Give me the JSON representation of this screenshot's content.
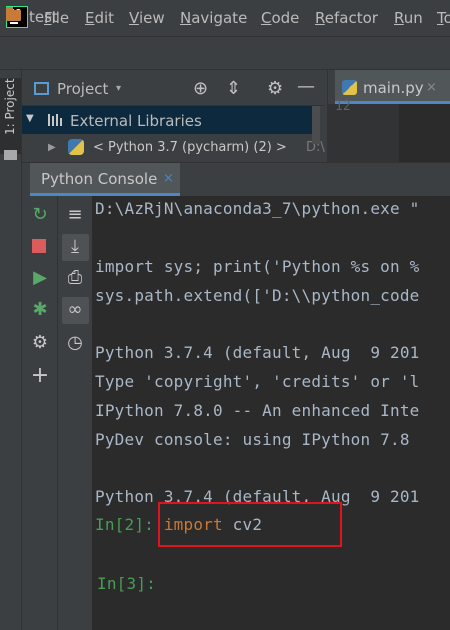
{
  "menubar": {
    "logo_text": "PC",
    "items": [
      "File",
      "Edit",
      "View",
      "Navigate",
      "Code",
      "Refactor",
      "Run",
      "To"
    ],
    "mnemonics": [
      "F",
      "E",
      "V",
      "N",
      "C",
      "R",
      "R",
      "T"
    ]
  },
  "navbar": {
    "project": "test"
  },
  "left_strip": {
    "project_tool": "1: Project"
  },
  "project_panel": {
    "title": "Project",
    "items": [
      {
        "label": "External Libraries",
        "selected": true,
        "expanded": true
      },
      {
        "label": "< Python 3.7 (pycharm) (2) >",
        "suffix": "D:\\",
        "expanded": false
      }
    ],
    "header_icons": [
      "crosshair-icon",
      "collapse-icon",
      "gear-icon",
      "hide-icon"
    ]
  },
  "editor": {
    "tab": "main.py",
    "tab_close": "×",
    "line_number": "12"
  },
  "console": {
    "tab": "Python Console",
    "tab_close": "×",
    "lines": [
      "D:\\AzRjN\\anaconda3_7\\python.exe \"",
      "import sys; print('Python %s on %",
      "sys.path.extend(['D:\\\\python_code",
      "Python 3.7.4 (default, Aug  9 201",
      "Type 'copyright', 'credits' or 'l",
      "IPython 7.8.0 -- An enhanced Inte",
      "PyDev console: using IPython 7.8",
      "Python 3.7.4 (default, Aug  9 201"
    ],
    "input_prompt": "In[2]:",
    "input_keyword": "import",
    "input_rest": " cv2",
    "next_prompt": "In[3]:"
  },
  "colors": {
    "background": "#2b2b2b",
    "chrome": "#3c3f41",
    "prompt_green": "#499c54",
    "keyword_orange": "#cc7832",
    "highlight_red": "#e0141e",
    "accent_blue": "#4a88c7"
  }
}
